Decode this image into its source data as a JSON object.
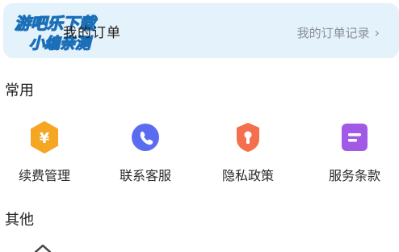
{
  "order_card": {
    "title": "我的订单",
    "link_label": "我的订单记录",
    "chevron": "›",
    "watermark_line1": "游吧乐下载",
    "watermark_line2": "小编亲测"
  },
  "sections": {
    "common_title": "常用",
    "other_title": "其他"
  },
  "common_items": [
    {
      "label": "续费管理",
      "icon": "yen-hexagon-icon",
      "color": "#f5a623"
    },
    {
      "label": "联系客服",
      "icon": "phone-circle-icon",
      "color": "#5b6cf0"
    },
    {
      "label": "隐私政策",
      "icon": "privacy-shield-icon",
      "color": "#f36f4e"
    },
    {
      "label": "服务条款",
      "icon": "terms-document-icon",
      "color": "#a05ae6"
    }
  ]
}
